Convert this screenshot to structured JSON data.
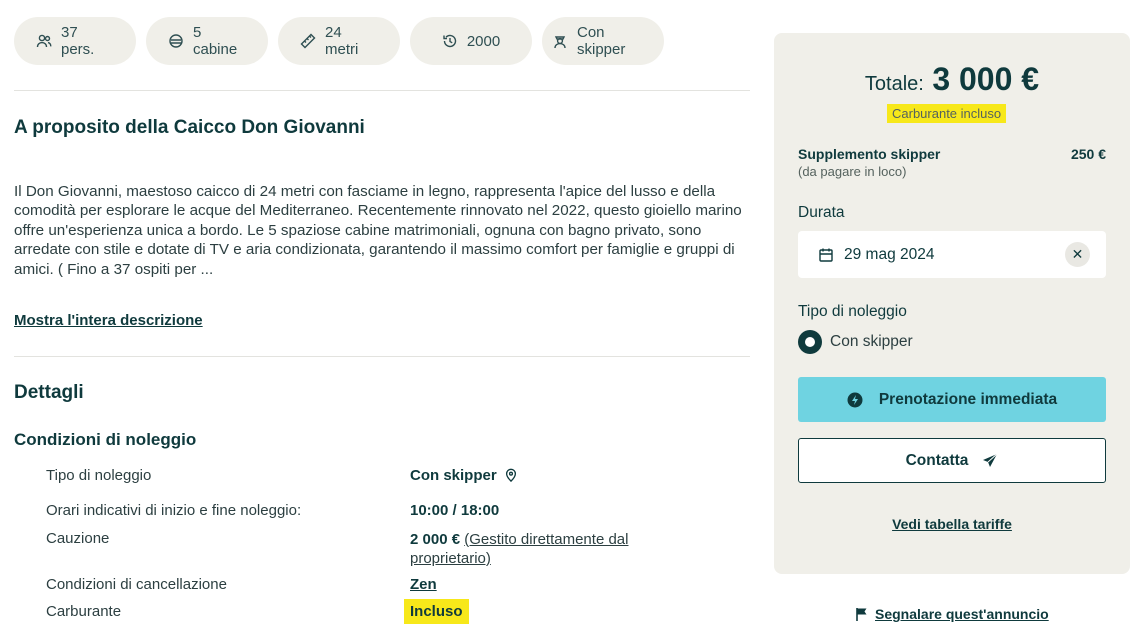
{
  "chips": [
    {
      "icon": "people-icon",
      "label": "37 pers."
    },
    {
      "icon": "cabin-icon",
      "label": "5 cabine"
    },
    {
      "icon": "ruler-icon",
      "label": "24 metri"
    },
    {
      "icon": "history-icon",
      "label": "2000"
    },
    {
      "icon": "skipper-icon",
      "label": "Con skipper"
    }
  ],
  "about": {
    "title": "A proposito della Caicco Don Giovanni",
    "description": "Il Don Giovanni, maestoso caicco di 24 metri con fasciame in legno, rappresenta l'apice del lusso e della comodità per esplorare le acque del Mediterraneo. Recentemente rinnovato nel 2022, questo gioiello marino offre un'esperienza unica a bordo. Le 5 spaziose cabine matrimoniali, ognuna con bagno privato, sono arredate con stile e dotate di TV e aria condizionata, garantendo il massimo comfort per famiglie e gruppi di amici. ( Fino a 37 ospiti per ...",
    "show_more": "Mostra l'intera descrizione"
  },
  "details": {
    "title": "Dettagli",
    "conditions_title": "Condizioni di noleggio",
    "rows": {
      "rental_type": {
        "key": "Tipo di noleggio",
        "value": "Con skipper"
      },
      "hours": {
        "key": "Orari indicativi di inizio e fine noleggio:",
        "value": "10:00 / 18:00"
      },
      "deposit": {
        "key": "Cauzione",
        "value": "2 000 €",
        "note": "(Gestito direttamente dal proprietario)"
      },
      "cancellation": {
        "key": "Condizioni di cancellazione",
        "value": "Zen"
      },
      "fuel": {
        "key": "Carburante",
        "value": "Incluso"
      }
    }
  },
  "booking": {
    "total_label": "Totale:",
    "total_amount": "3 000 €",
    "fuel_note": "Carburante incluso",
    "skipper_supplement": "Supplemento skipper",
    "skipper_note": "(da pagare in loco)",
    "skipper_price": "250 €",
    "duration_label": "Durata",
    "date_value": "29 mag 2024",
    "rental_type_label": "Tipo di noleggio",
    "rental_option": "Con skipper",
    "instant_booking": "Prenotazione immediata",
    "contact": "Contatta",
    "rates_link": "Vedi tabella tariffe"
  },
  "report_link": "Segnalare quest'annuncio",
  "colors": {
    "primary_text": "#0f3a3d",
    "chip_bg": "#f0efe9",
    "panel_bg": "#f0efe9",
    "accent_button": "#6fd3e1",
    "highlight": "#f7e81a"
  }
}
